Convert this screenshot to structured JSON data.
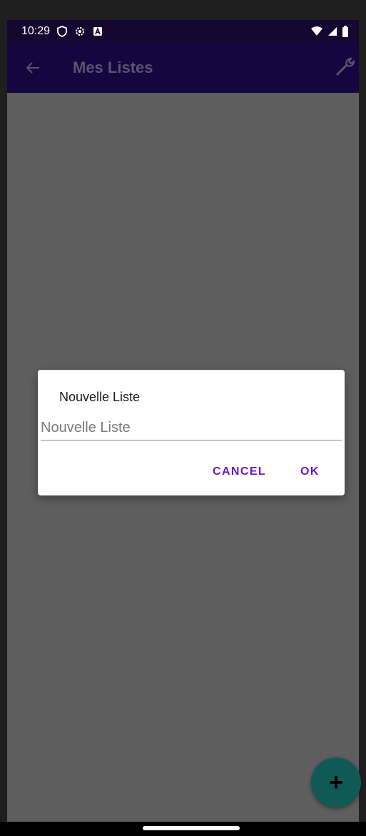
{
  "status_bar": {
    "time": "10:29",
    "left_icons": [
      "shield-icon",
      "settings-icon",
      "keyboard-a-icon"
    ],
    "right_icons": [
      "wifi-icon",
      "signal-icon",
      "battery-icon"
    ]
  },
  "app_bar": {
    "back_icon": "arrow-left-icon",
    "title": "Mes Listes",
    "action_icon": "wrench-icon"
  },
  "dialog": {
    "title": "Nouvelle Liste",
    "input_value": "",
    "input_placeholder": "Nouvelle Liste",
    "cancel_label": "CANCEL",
    "ok_label": "OK"
  },
  "fab": {
    "label": "+",
    "icon": "plus-icon"
  },
  "colors": {
    "app_bar": "#160640",
    "status_bar": "#150730",
    "scrim": "#5e5e5e",
    "dialog_button": "#6a18c8",
    "fab": "#0f5a55"
  }
}
